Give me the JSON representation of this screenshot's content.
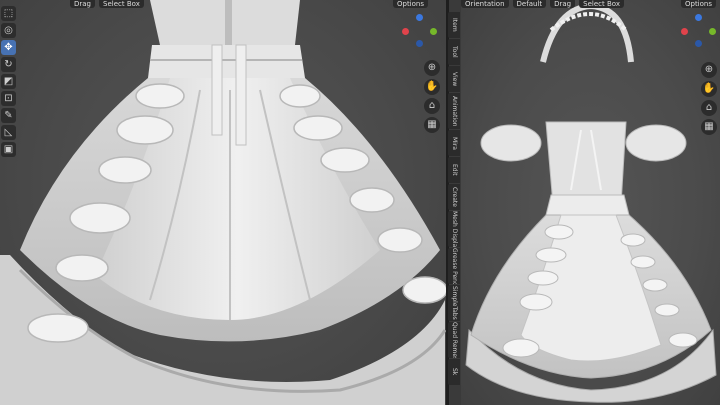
{
  "left_viewport": {
    "header": [
      "Drag",
      "Select Box"
    ],
    "options": "Options",
    "tools": [
      "select-box",
      "cursor",
      "move",
      "rotate",
      "scale",
      "transform",
      "annotate",
      "measure",
      "add-cube"
    ],
    "active_tool": "move",
    "nav": [
      "zoom",
      "pan",
      "camera",
      "perspective"
    ]
  },
  "right_viewport": {
    "header": [
      "Orientation",
      "Default",
      "Drag",
      "Select Box"
    ],
    "options": "Options",
    "nav": [
      "zoom",
      "pan",
      "camera",
      "perspective"
    ]
  },
  "sidebar_tabs": [
    "Item",
    "Tool",
    "View",
    "Animation",
    "Mira",
    "Edit",
    "Create",
    "Mesh Display",
    "Grease Pencil",
    "SimpleTabs",
    "Quad Remesh",
    "Sk"
  ],
  "colors": {
    "accent": "#4772b3",
    "x_axis": "#e0434b",
    "y_axis": "#76b82a",
    "z_axis": "#3b78e0",
    "cloth": "#e8e8e8"
  }
}
